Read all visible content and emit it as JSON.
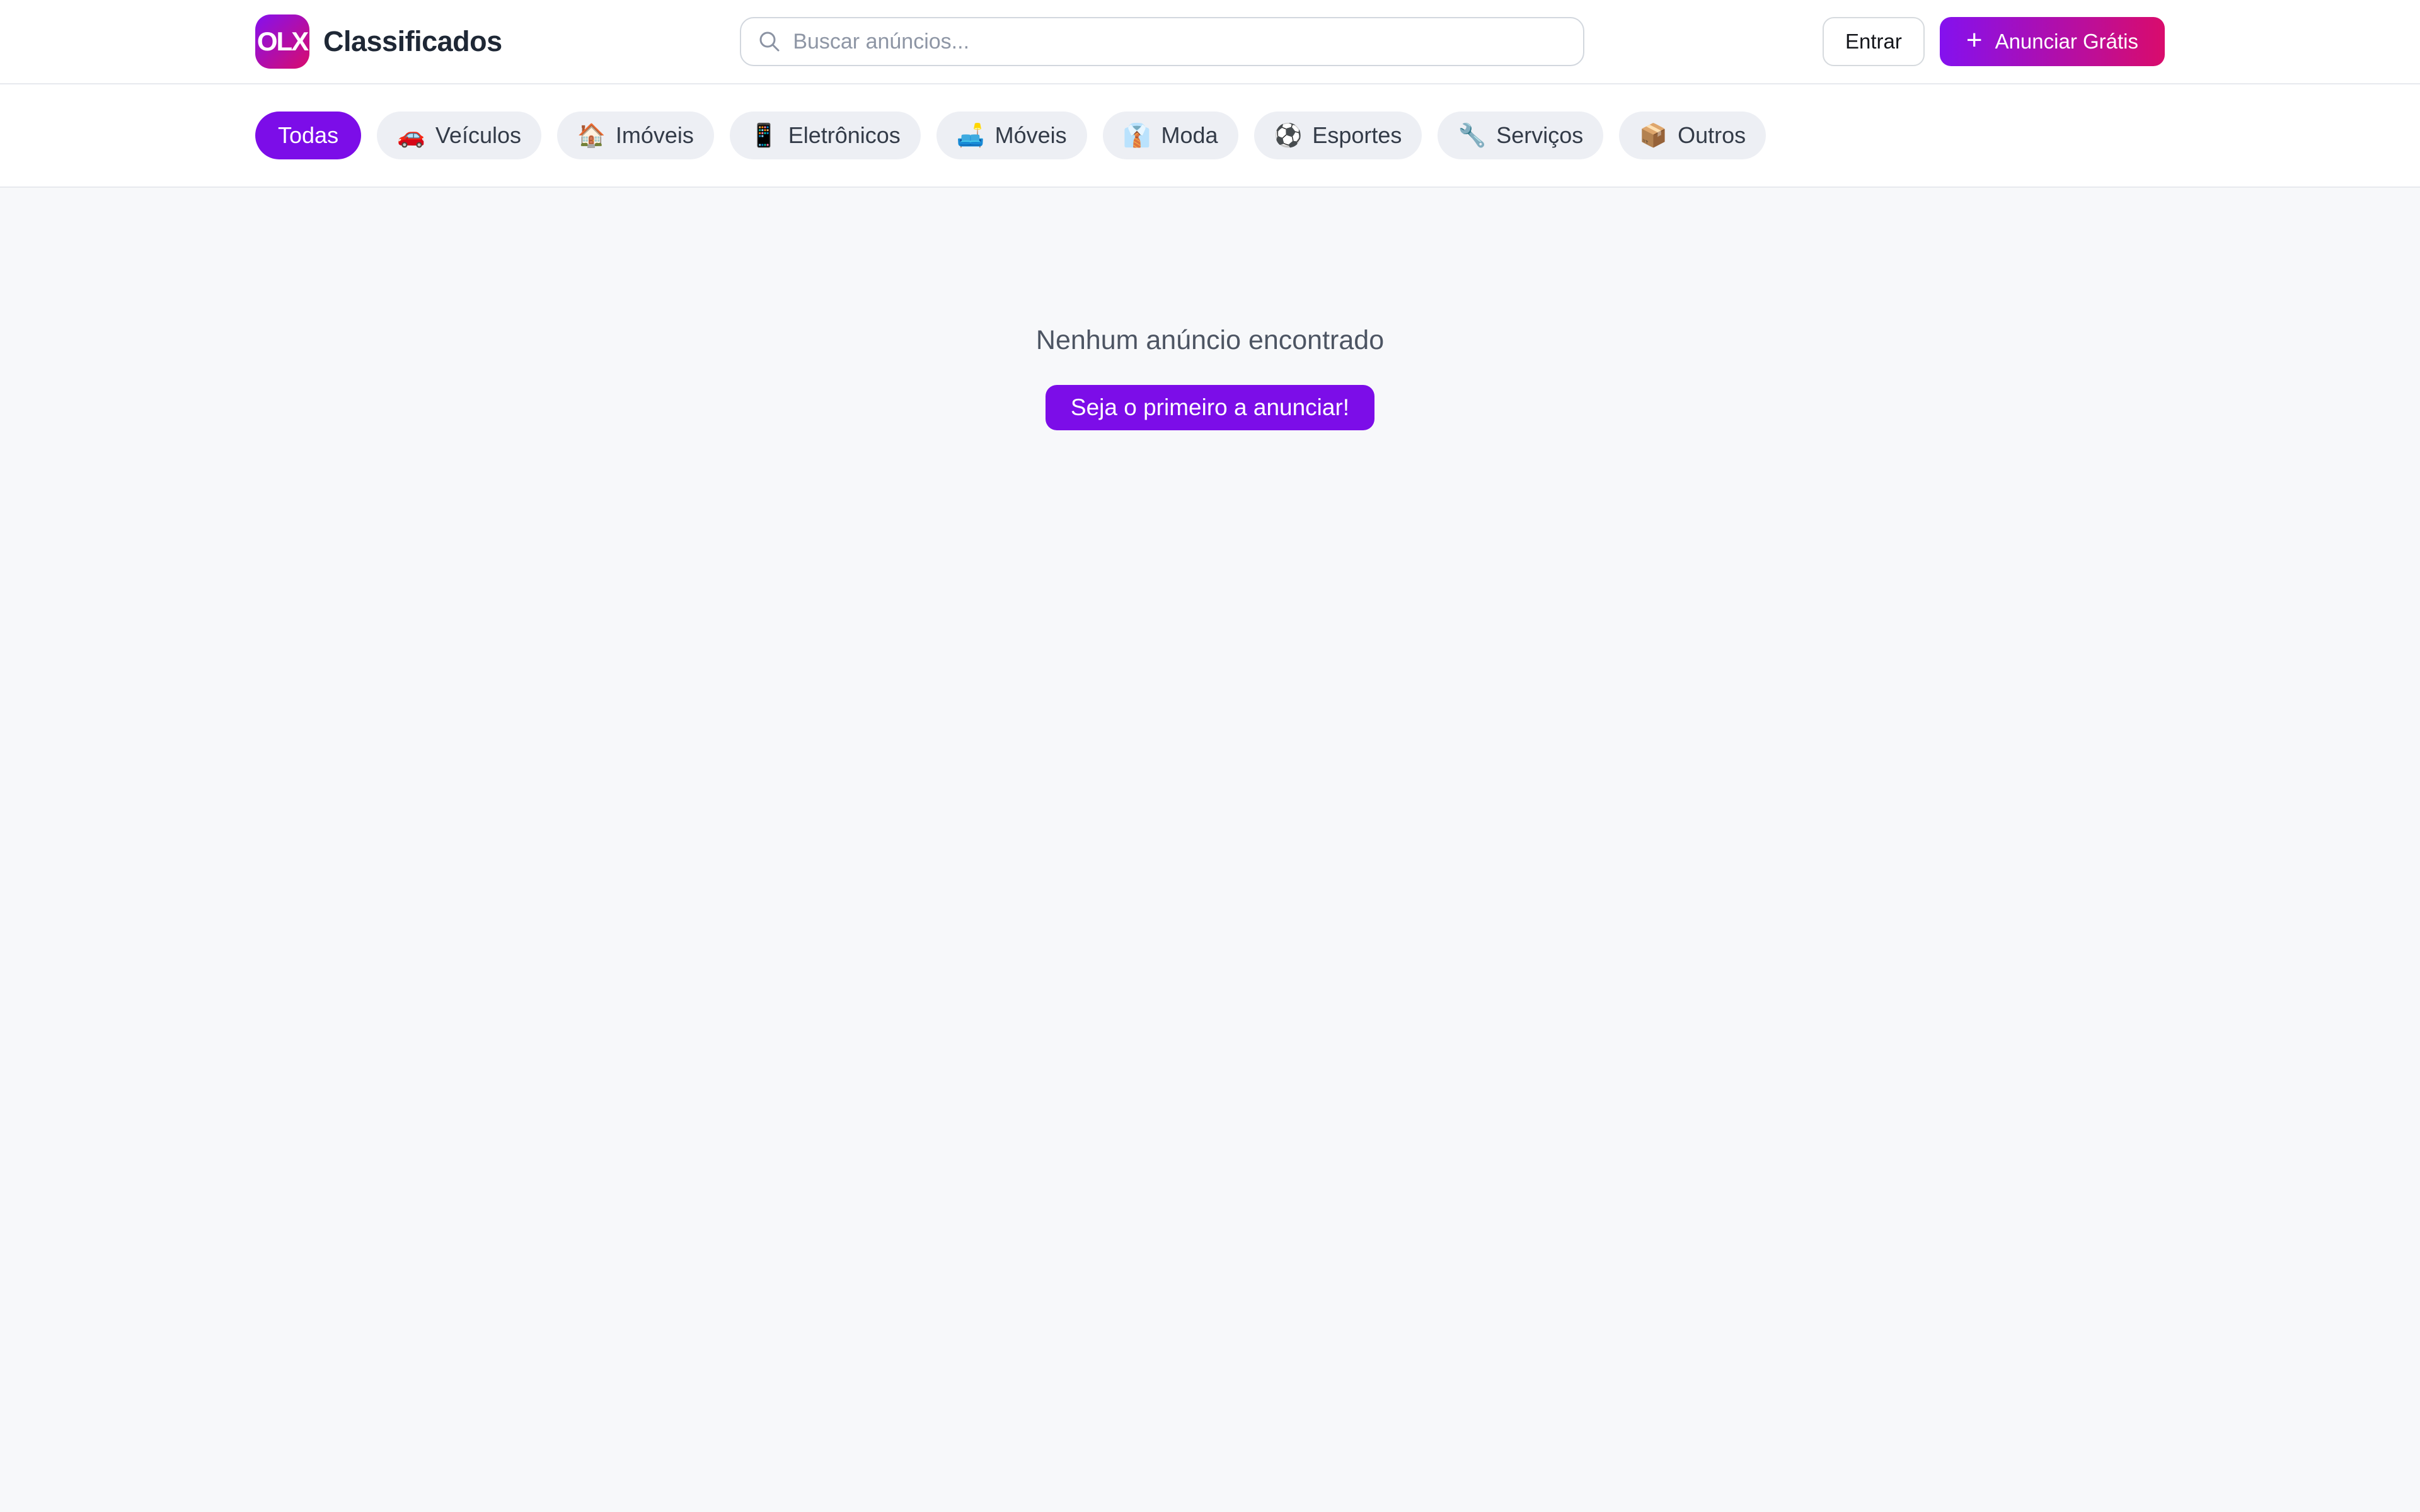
{
  "header": {
    "logo_text": "OLX",
    "brand_name": "Classificados",
    "search_placeholder": "Buscar anúncios...",
    "login_label": "Entrar",
    "plus_icon": "+",
    "post_ad_label": "Anunciar Grátis"
  },
  "categories": [
    {
      "label": "Todas",
      "icon": "",
      "active": true
    },
    {
      "label": "Veículos",
      "icon": "🚗",
      "active": false
    },
    {
      "label": "Imóveis",
      "icon": "🏠",
      "active": false
    },
    {
      "label": "Eletrônicos",
      "icon": "📱",
      "active": false
    },
    {
      "label": "Móveis",
      "icon": "🛋️",
      "active": false
    },
    {
      "label": "Moda",
      "icon": "👔",
      "active": false
    },
    {
      "label": "Esportes",
      "icon": "⚽",
      "active": false
    },
    {
      "label": "Serviços",
      "icon": "🔧",
      "active": false
    },
    {
      "label": "Outros",
      "icon": "📦",
      "active": false
    }
  ],
  "main": {
    "empty_message": "Nenhum anúncio encontrado",
    "cta_label": "Seja o primeiro a anunciar!"
  },
  "colors": {
    "accent": "#7c0de8",
    "gradient-start": "#8411ef",
    "gradient-end": "#d90c6c"
  }
}
